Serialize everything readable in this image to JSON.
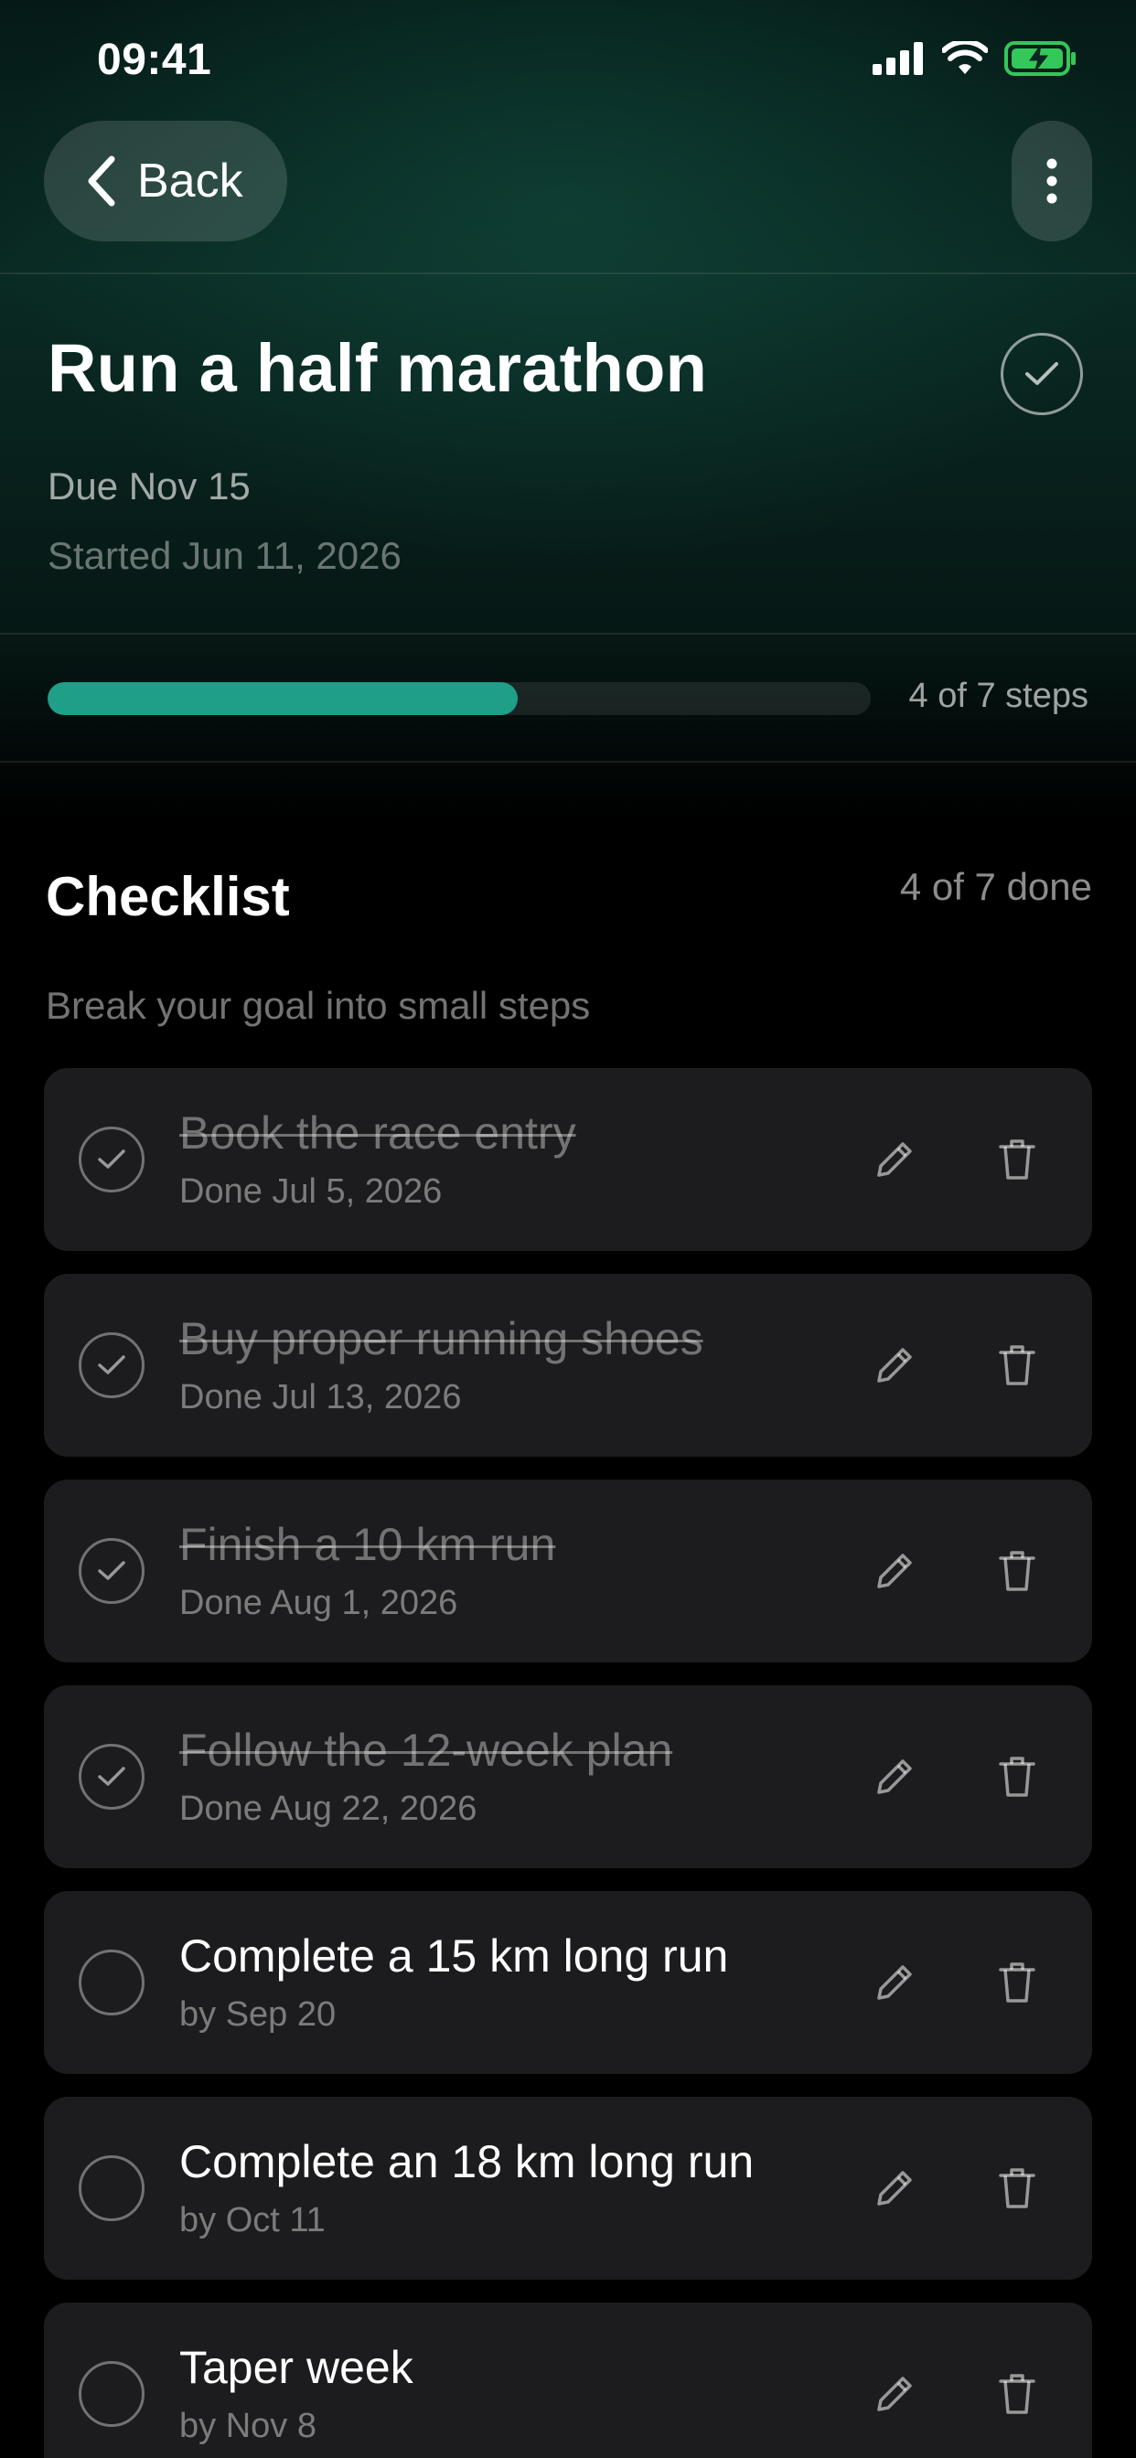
{
  "status_bar": {
    "time": "09:41"
  },
  "nav": {
    "back_label": "Back"
  },
  "goal": {
    "title": "Run a half marathon",
    "due": "Due Nov 15",
    "started": "Started Jun 11, 2026"
  },
  "progress": {
    "completed": 4,
    "total": 7,
    "label": "4 of 7 steps"
  },
  "checklist": {
    "title": "Checklist",
    "count_label": "4 of 7 done",
    "subtitle": "Break your goal into small steps",
    "items": [
      {
        "title": "Book the race entry",
        "sub": "Done Jul 5, 2026",
        "done": true
      },
      {
        "title": "Buy proper running shoes",
        "sub": "Done Jul 13, 2026",
        "done": true
      },
      {
        "title": "Finish a 10 km run",
        "sub": "Done Aug 1, 2026",
        "done": true
      },
      {
        "title": "Follow the 12-week plan",
        "sub": "Done Aug 22, 2026",
        "done": true
      },
      {
        "title": "Complete a 15 km long run",
        "sub": "by Sep 20",
        "done": false
      },
      {
        "title": "Complete an 18 km long run",
        "sub": "by Oct 11",
        "done": false
      },
      {
        "title": "Taper week",
        "sub": "by Nov 8",
        "done": false
      }
    ]
  },
  "colors": {
    "accent": "#1f9e88",
    "card": "#1c1c1e",
    "battery": "#34c759"
  },
  "icons": {
    "back": "chevron-left-icon",
    "more": "more-vertical-icon",
    "goal_complete": "check-circle-icon",
    "edit": "pencil-icon",
    "delete": "trash-icon"
  }
}
